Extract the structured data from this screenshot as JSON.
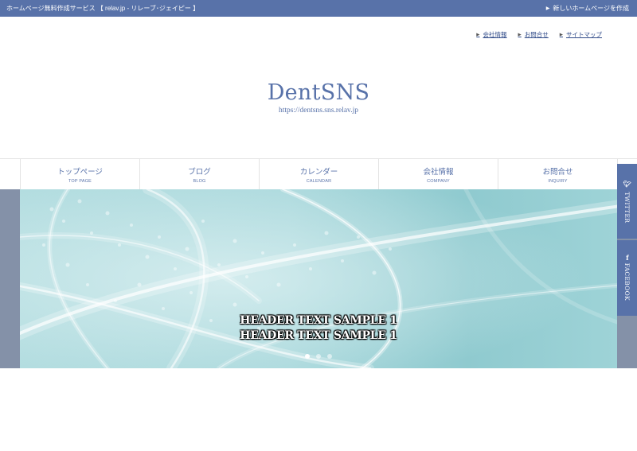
{
  "topbar": {
    "left_text": "ホームページ無料作成サービス 【 relav.jp - リレーブ･ジェイピー 】",
    "right_text": "新しいホームページを作成"
  },
  "util_links": [
    "会社情報",
    "お問合せ",
    "サイトマップ"
  ],
  "site": {
    "title": "DentSNS",
    "url": "https://dentsns.sns.relav.jp"
  },
  "nav": [
    {
      "jp": "トップページ",
      "en": "TOP PAGE"
    },
    {
      "jp": "ブログ",
      "en": "BLOG"
    },
    {
      "jp": "カレンダー",
      "en": "CALENDAR"
    },
    {
      "jp": "会社情報",
      "en": "COMPANY"
    },
    {
      "jp": "お問合せ",
      "en": "INQUIRY"
    }
  ],
  "hero": {
    "line1": "HEADER TEXT SAMPLE 1",
    "line2": "HEADER TEXT SAMPLE 1",
    "slide_count": 3,
    "active_slide": 1
  },
  "social": {
    "twitter": "TWITTER",
    "facebook": "FACEBOOK",
    "twitter_icon": "twitter-bird-icon",
    "facebook_icon": "facebook-f-icon"
  },
  "colors": {
    "brand": "#5872a9",
    "hero_side": "#8491a8"
  }
}
